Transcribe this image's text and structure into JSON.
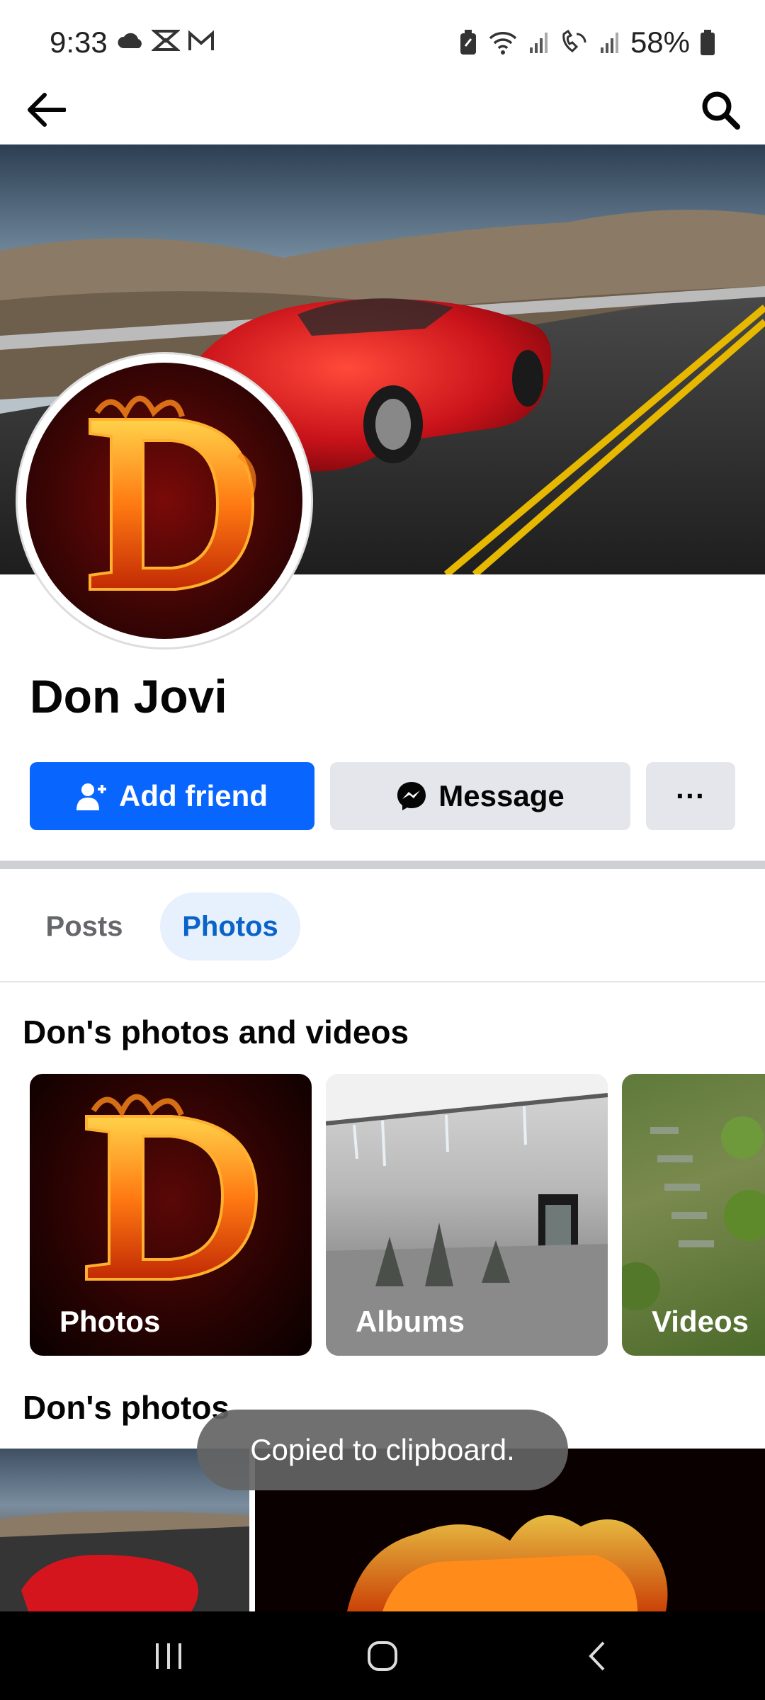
{
  "status_bar": {
    "time": "9:33",
    "battery": "58%",
    "left_icons": [
      "cloud-icon",
      "envelope-x-icon",
      "gmail-icon"
    ],
    "right_icons": [
      "battery-saver-icon",
      "wifi-icon",
      "signal-icon",
      "wifi-calling-icon",
      "signal-icon",
      "battery-icon"
    ]
  },
  "app_bar": {
    "back_icon": "arrow-left-icon",
    "search_icon": "search-icon"
  },
  "profile": {
    "name": "Don Jovi",
    "cover_desc_icon": "cover-photo",
    "avatar_letter": "D"
  },
  "actions": {
    "add_friend_label": "Add friend",
    "message_label": "Message",
    "more_label": "···"
  },
  "tabs": [
    {
      "label": "Posts",
      "active": false
    },
    {
      "label": "Photos",
      "active": true
    }
  ],
  "sections": {
    "media_title": "Don's photos and videos",
    "photos_title": "Don's photos"
  },
  "media_cards": [
    {
      "label": "Photos"
    },
    {
      "label": "Albums"
    },
    {
      "label": "Videos"
    }
  ],
  "toast": {
    "text": "Copied to clipboard."
  },
  "colors": {
    "primary": "#0866ff",
    "tab_active_bg": "#e7f0fd",
    "secondary_button": "#e4e6eb"
  }
}
